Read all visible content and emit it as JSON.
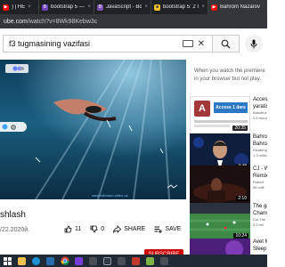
{
  "tabs": [
    {
      "label": ") | HE",
      "favicon_color": "#ff0000",
      "favicon_glyph": "▶"
    },
    {
      "label": "bootstrap 5 — Sk",
      "favicon_color": "#6f42c1",
      "favicon_glyph": "B"
    },
    {
      "label": "JavaScript - Boots",
      "favicon_color": "#7952b3",
      "favicon_glyph": "B"
    },
    {
      "label": "bootstrap 5: 2 Il",
      "favicon_color": "#f6c12b",
      "favicon_glyph": "■"
    },
    {
      "label": "Bahrom Nazarov",
      "favicon_color": "#ff0000",
      "favicon_glyph": "▶"
    }
  ],
  "active_tab": 4,
  "address_bar": {
    "domain": "ube.com",
    "path": "/watch?v=8Wk98Kebw3c"
  },
  "search": {
    "query": "f3 tugmasining vazifasi"
  },
  "video": {
    "title": "shlash",
    "date": "/22.2020й.",
    "watermark": "www.bilimdon-video.uz",
    "progress": 0,
    "likes": "11",
    "dislikes": "0",
    "share_label": "SHARE",
    "save_label": "SAVE",
    "more_label": "•••"
  },
  "sidebar": {
    "notice": "When you watch the premiere in your browser but not play.",
    "recommendations": [
      {
        "title": "Access",
        "title2": "yaratis",
        "channel": "Basoftuz",
        "views": "2.6 thous",
        "duration": "20:35",
        "thumb": "access",
        "thumb_text": "Access 1 dars"
      },
      {
        "title": "Bahrom",
        "title2": "Bahrom",
        "channel": "Rizafeng",
        "views": "1.3 million",
        "duration": "3:48",
        "thumb": "portrait"
      },
      {
        "title": "CJ - W",
        "title2": "Remix",
        "channel": "Robert",
        "views": "56 milli",
        "duration": "2:10",
        "thumb": "dark"
      },
      {
        "title": "The gr",
        "title2": "Champ",
        "channel": "Cut The",
        "views": "3.5 mil",
        "duration": "10:24",
        "thumb": "stadium"
      },
      {
        "title": "Avet M",
        "title2": "Sleep",
        "channel": "",
        "views": "",
        "duration": "",
        "thumb": "purple"
      }
    ]
  },
  "subscribe_label": "SUBSCRIBE",
  "colors": {
    "youtube_red": "#ff0000",
    "subscribe_red": "#cc0000",
    "water": "#0a3147"
  }
}
